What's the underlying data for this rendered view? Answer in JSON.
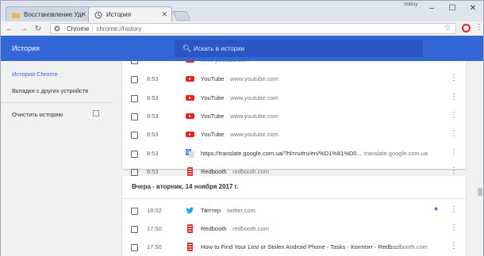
{
  "tabs": [
    {
      "label": "Восстановление Удале",
      "icon": "folder-star-icon"
    },
    {
      "label": "История",
      "icon": "history-icon"
    }
  ],
  "window": {
    "user": "Volksy"
  },
  "toolbar": {
    "site": "Chrome",
    "url": "chrome://history"
  },
  "appbar": {
    "title": "История",
    "search_placeholder": "Искать в истории"
  },
  "sidebar": {
    "items": [
      {
        "label": "История Chrome"
      },
      {
        "label": "Вкладки с других устройств"
      },
      {
        "label": "Очистить историю"
      }
    ]
  },
  "today": [
    {
      "time": "8:53",
      "title": "YouTube",
      "domain": "www.youtube.com",
      "icon": "youtube-icon"
    },
    {
      "time": "8:53",
      "title": "YouTube",
      "domain": "www.youtube.com",
      "icon": "youtube-icon"
    },
    {
      "time": "8:53",
      "title": "YouTube",
      "domain": "www.youtube.com",
      "icon": "youtube-icon"
    },
    {
      "time": "8:53",
      "title": "YouTube",
      "domain": "www.youtube.com",
      "icon": "youtube-icon"
    },
    {
      "time": "8:53",
      "title": "https://translate.google.com.ua/?hl=ru#ru/en/%D1%81%D0...",
      "domain": "translate.google.com.ua",
      "icon": "translate-icon"
    },
    {
      "time": "8:53",
      "title": "Redbooth",
      "domain": "redbooth.com",
      "icon": "redbooth-icon"
    }
  ],
  "yesterday": {
    "heading": "Вчера - вторник, 14 ноября 2017 г.",
    "rows": [
      {
        "time": "18:02",
        "title": "Твіттер",
        "domain": "twitter.com",
        "icon": "twitter-icon",
        "starred": true
      },
      {
        "time": "17:50",
        "title": "Redbooth",
        "domain": "redbooth.com",
        "icon": "redbooth-icon"
      },
      {
        "time": "17:50",
        "title": "How to Find Your Lost or Stolen Android Phone - Tasks - Контент - Redb...",
        "domain": "redbooth.com",
        "icon": "redbooth-icon"
      }
    ]
  },
  "colors": {
    "accent": "#3367d6",
    "youtube": "#e62117",
    "twitter": "#1da1f2",
    "redbooth": "#e03131"
  }
}
